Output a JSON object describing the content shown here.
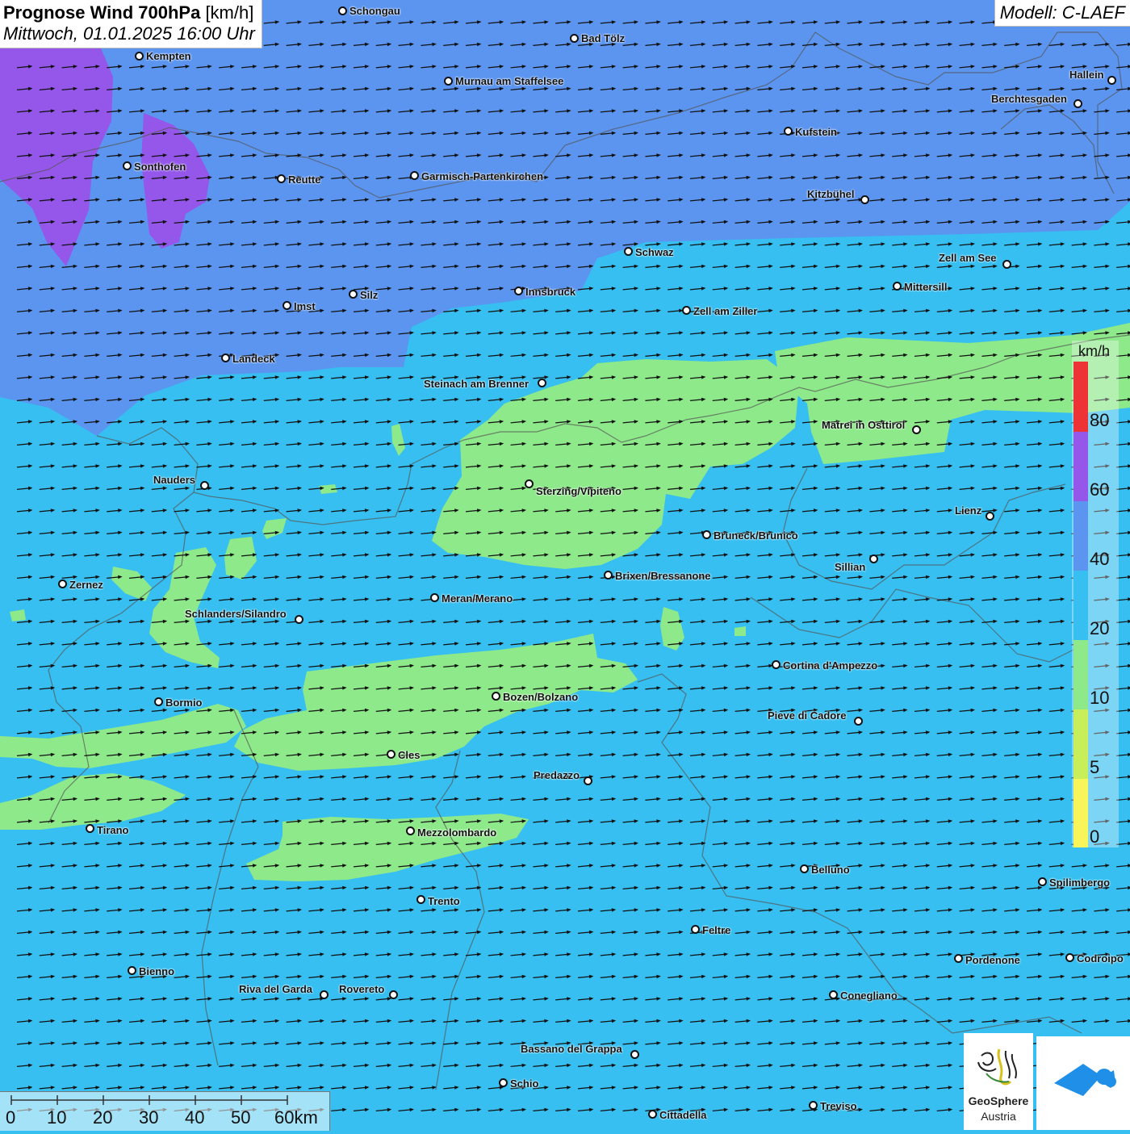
{
  "title": {
    "bold": "Prognose Wind 700hPa",
    "unit": "[km/h]",
    "datetime": "Mittwoch, 01.01.2025 16:00 Uhr"
  },
  "model": "Modell: C-LAEF",
  "colors": {
    "wind_0_5": "#f7f55a",
    "wind_5_10": "#c8ef5a",
    "wind_10_20": "#8ee98a",
    "wind_20_40": "#36bff0",
    "wind_40_60": "#5b95f0",
    "wind_60_80": "#9457ea",
    "wind_80_plus": "#ee3336",
    "arrow": "#111111"
  },
  "legend": {
    "unit": "km/h",
    "labels": [
      "80",
      "60",
      "40",
      "20",
      "10",
      "5",
      "0"
    ]
  },
  "wind_direction": "west-southwest to east-northeast",
  "cities": [
    {
      "name": "Schongau"
    },
    {
      "name": "Bad Tölz"
    },
    {
      "name": "Kempten"
    },
    {
      "name": "Murnau am Staffelsee"
    },
    {
      "name": "Hallein"
    },
    {
      "name": "Berchtesgaden"
    },
    {
      "name": "Kufstein"
    },
    {
      "name": "Sonthofen"
    },
    {
      "name": "Reutte"
    },
    {
      "name": "Garmisch-Partenkirchen"
    },
    {
      "name": "Kitzbühel"
    },
    {
      "name": "Schwaz"
    },
    {
      "name": "Zell am See"
    },
    {
      "name": "Innsbruck"
    },
    {
      "name": "Mittersill"
    },
    {
      "name": "Imst"
    },
    {
      "name": "Silz"
    },
    {
      "name": "Zell am Ziller"
    },
    {
      "name": "Landeck"
    },
    {
      "name": "Steinach am Brenner"
    },
    {
      "name": "Matrei in Osttirol"
    },
    {
      "name": "Nauders"
    },
    {
      "name": "Sterzing/Vipiteno"
    },
    {
      "name": "Lienz"
    },
    {
      "name": "Bruneck/Brunico"
    },
    {
      "name": "Sillian"
    },
    {
      "name": "Zernez"
    },
    {
      "name": "Brixen/Bressanone"
    },
    {
      "name": "Meran/Merano"
    },
    {
      "name": "Schlanders/Silandro"
    },
    {
      "name": "Cortina d'Ampezzo"
    },
    {
      "name": "Bozen/Bolzano"
    },
    {
      "name": "Bormio"
    },
    {
      "name": "Pieve di Cadore"
    },
    {
      "name": "Cles"
    },
    {
      "name": "Predazzo"
    },
    {
      "name": "Tirano"
    },
    {
      "name": "Mezzolombardo"
    },
    {
      "name": "Belluno"
    },
    {
      "name": "Spilimbergo"
    },
    {
      "name": "Trento"
    },
    {
      "name": "Feltre"
    },
    {
      "name": "Pordenone"
    },
    {
      "name": "Codroipo"
    },
    {
      "name": "Bienno"
    },
    {
      "name": "Riva del Garda"
    },
    {
      "name": "Rovereto"
    },
    {
      "name": "Conegliano"
    },
    {
      "name": "Bassano del Grappa"
    },
    {
      "name": "Schio"
    },
    {
      "name": "Treviso"
    },
    {
      "name": "Cittadella"
    }
  ],
  "scale": {
    "labels": [
      "0",
      "10",
      "20",
      "30",
      "40",
      "50",
      "60km"
    ]
  },
  "logo": {
    "line1": "GeoSphere",
    "line2": "Austria"
  }
}
